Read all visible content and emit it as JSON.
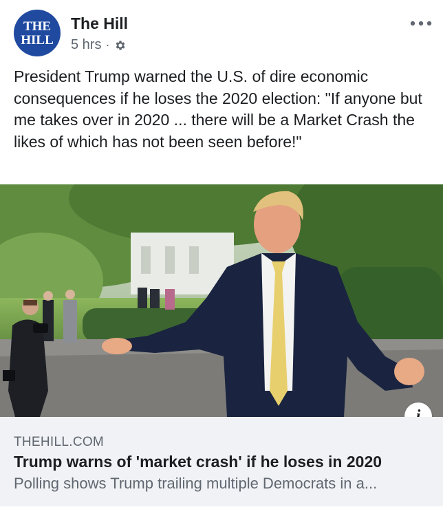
{
  "post": {
    "author": {
      "name": "The Hill",
      "avatar_line1": "THE",
      "avatar_line2": "HILL"
    },
    "timestamp": "5 hrs",
    "separator": "·",
    "audience_icon": "gear-icon",
    "more_icon": "more-horizontal-icon",
    "caption": "President Trump warned the U.S. of dire economic consequences if he loses the 2020 election: \"If anyone but me takes over in 2020 ... there will be a Market Crash the likes of which has not been seen before!\""
  },
  "link_preview": {
    "domain": "THEHILL.COM",
    "title": "Trump warns of 'market crash' if he loses in 2020",
    "description": "Polling shows Trump trailing multiple Democrats in a...",
    "info_label": "i"
  },
  "colors": {
    "avatar_bg": "#1f4aa0",
    "text_primary": "#1c1e21",
    "text_secondary": "#606770",
    "link_box_bg": "#f0f2f5"
  }
}
